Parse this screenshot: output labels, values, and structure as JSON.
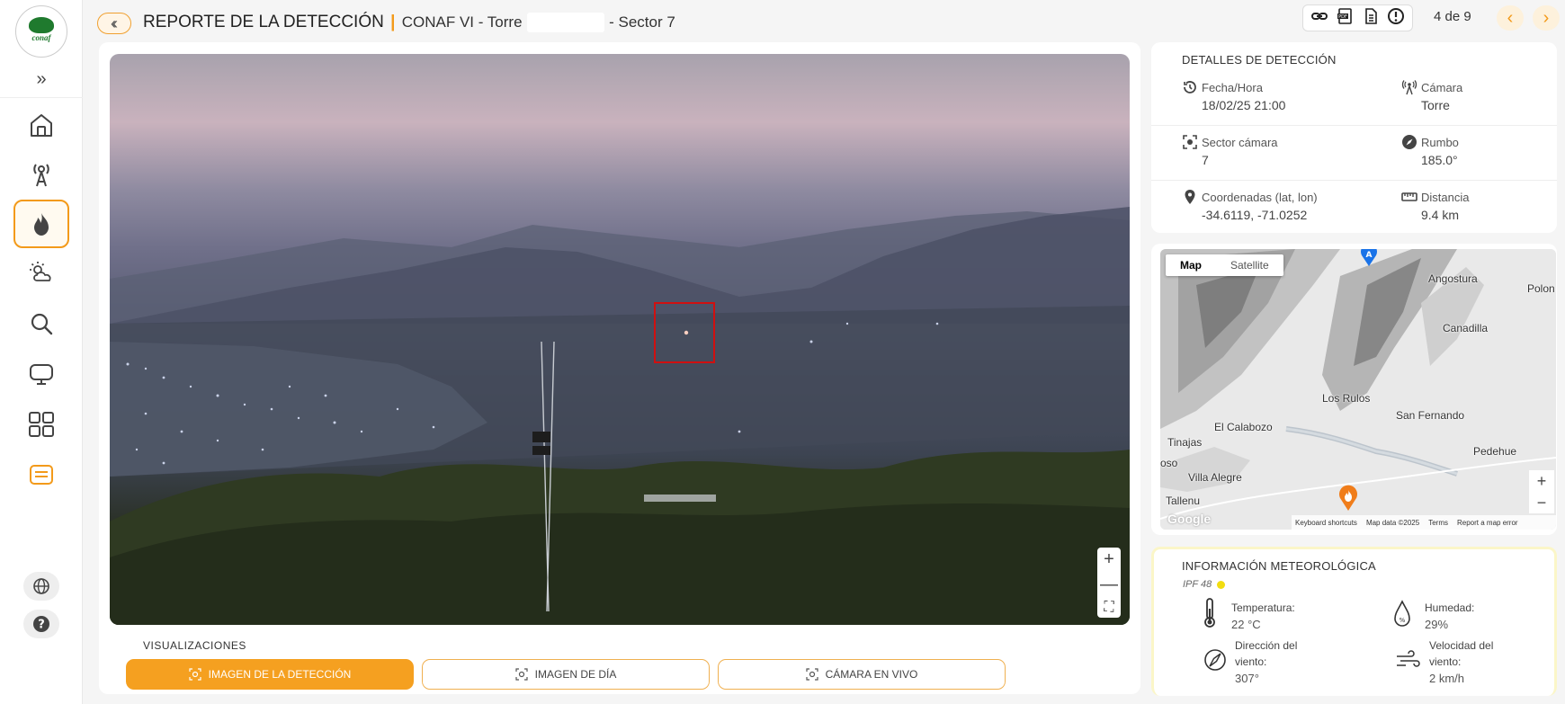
{
  "sidebar": {
    "logo_text": "conaf",
    "expand_icon": "chevrons-right-icon",
    "items": [
      {
        "icon": "home-icon"
      },
      {
        "icon": "antenna-icon"
      },
      {
        "icon": "fire-icon",
        "active": true
      },
      {
        "icon": "weather-icon"
      },
      {
        "icon": "search-icon"
      },
      {
        "icon": "monitor-icon"
      },
      {
        "icon": "grid-icon"
      },
      {
        "icon": "report-icon"
      }
    ],
    "bottom": [
      "globe-icon",
      "help-icon"
    ]
  },
  "header": {
    "title": "REPORTE DE LA DETECCIÓN",
    "separator": "|",
    "subtitle_prefix": "CONAF VI - Torre",
    "subtitle_suffix": "- Sector 7",
    "toolbar": [
      "link-icon",
      "pdf-icon",
      "document-icon",
      "alert-icon"
    ],
    "counter": "4 de 9",
    "prev": "‹",
    "next": "›"
  },
  "visualizations": {
    "label": "VISUALIZACIONES",
    "buttons": [
      {
        "label": "IMAGEN DE LA DETECCIÓN",
        "active": true
      },
      {
        "label": "IMAGEN DE DÍA",
        "active": false
      },
      {
        "label": "CÁMARA EN VIVO",
        "active": false
      }
    ]
  },
  "photo_zoom": {
    "plus": "+",
    "minus": "—",
    "fullscreen": "⛶"
  },
  "details": {
    "heading": "DETALLES DE DETECCIÓN",
    "fecha": {
      "label": "Fecha/Hora",
      "value": "18/02/25 21:00"
    },
    "camara": {
      "label": "Cámara",
      "value": "Torre"
    },
    "sector": {
      "label": "Sector cámara",
      "value": "7"
    },
    "rumbo": {
      "label": "Rumbo",
      "value": "185.0°"
    },
    "coords": {
      "label": "Coordenadas (lat, lon)",
      "value": "-34.6119, -71.0252"
    },
    "distancia": {
      "label": "Distancia",
      "value": "9.4 km"
    }
  },
  "map": {
    "tabs": [
      "Map",
      "Satellite"
    ],
    "places": [
      "Angostura",
      "Polon",
      "Canadilla",
      "Los Rulos",
      "San Fernando",
      "El Calabozo",
      "Pedehue",
      "Tinajas",
      "oso",
      "Villa Alegre",
      "Tallenu"
    ],
    "pin_top": "A",
    "zoom_plus": "+",
    "zoom_minus": "−",
    "google": "Google",
    "footer": [
      "Keyboard shortcuts",
      "Map data ©2025",
      "Terms",
      "Report a map error"
    ]
  },
  "weather": {
    "heading": "INFORMACIÓN METEOROLÓGICA",
    "ipf": "IPF 48",
    "ipf_color": "#f2dd10",
    "temperatura": {
      "label": "Temperatura:",
      "value": "22 °C"
    },
    "humedad": {
      "label": "Humedad:",
      "value": "29%"
    },
    "direccion": {
      "label_1": "Dirección del",
      "label_2": "viento:",
      "value": "307°"
    },
    "velocidad": {
      "label_1": "Velocidad del",
      "label_2": "viento:",
      "value": "2 km/h"
    }
  },
  "colors": {
    "accent": "#f5a020",
    "detection_box": "#d01010"
  }
}
